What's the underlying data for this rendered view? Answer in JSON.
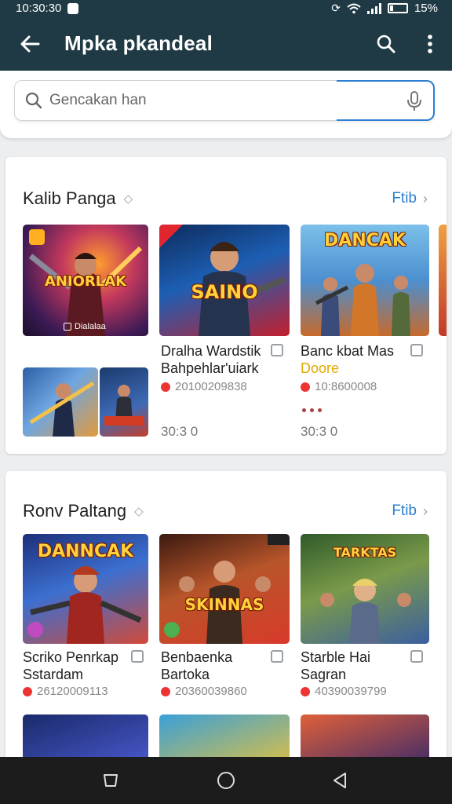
{
  "status": {
    "time": "10:30:30",
    "battery": "15%"
  },
  "appbar": {
    "title": "Mpka pkandeal"
  },
  "search": {
    "placeholder": "Gencakan han"
  },
  "sections": [
    {
      "title": "Kalib Panga",
      "more": "Ftib",
      "items": [
        {
          "art_title": "ANIORLAK",
          "caption": "Dialalaa"
        },
        {
          "art_title": "SAINO",
          "title_line1": "Dralha Wardstik",
          "title_line2": "Bahpehlar'uiark",
          "meta": "20100209838",
          "price": "30:3 0"
        },
        {
          "art_title": "DANCAK",
          "title_line1": "Banc kbat Mas",
          "title_line2": "Doore",
          "meta": "10:8600008",
          "price": "30:3 0"
        },
        {
          "art_title": ""
        }
      ]
    },
    {
      "title": "Ronv Paltang",
      "more": "Ftib",
      "items": [
        {
          "art_title": "DANNCAK",
          "title_line1": "Scriko Penrkap",
          "title_line2": "Sstardam",
          "meta": "26120009113"
        },
        {
          "art_title": "SKINNAS",
          "title_line1": "Benbaenka",
          "title_line2": "Bartoka",
          "meta": "20360039860"
        },
        {
          "art_title": "TARKTAS",
          "title_line1": "Starble Hai",
          "title_line2": "Sagran",
          "meta": "40390039799"
        }
      ]
    }
  ],
  "colors": {
    "appbar": "#1f3a44",
    "accent": "#2a7fd0",
    "meta_dot": "#e33333"
  }
}
